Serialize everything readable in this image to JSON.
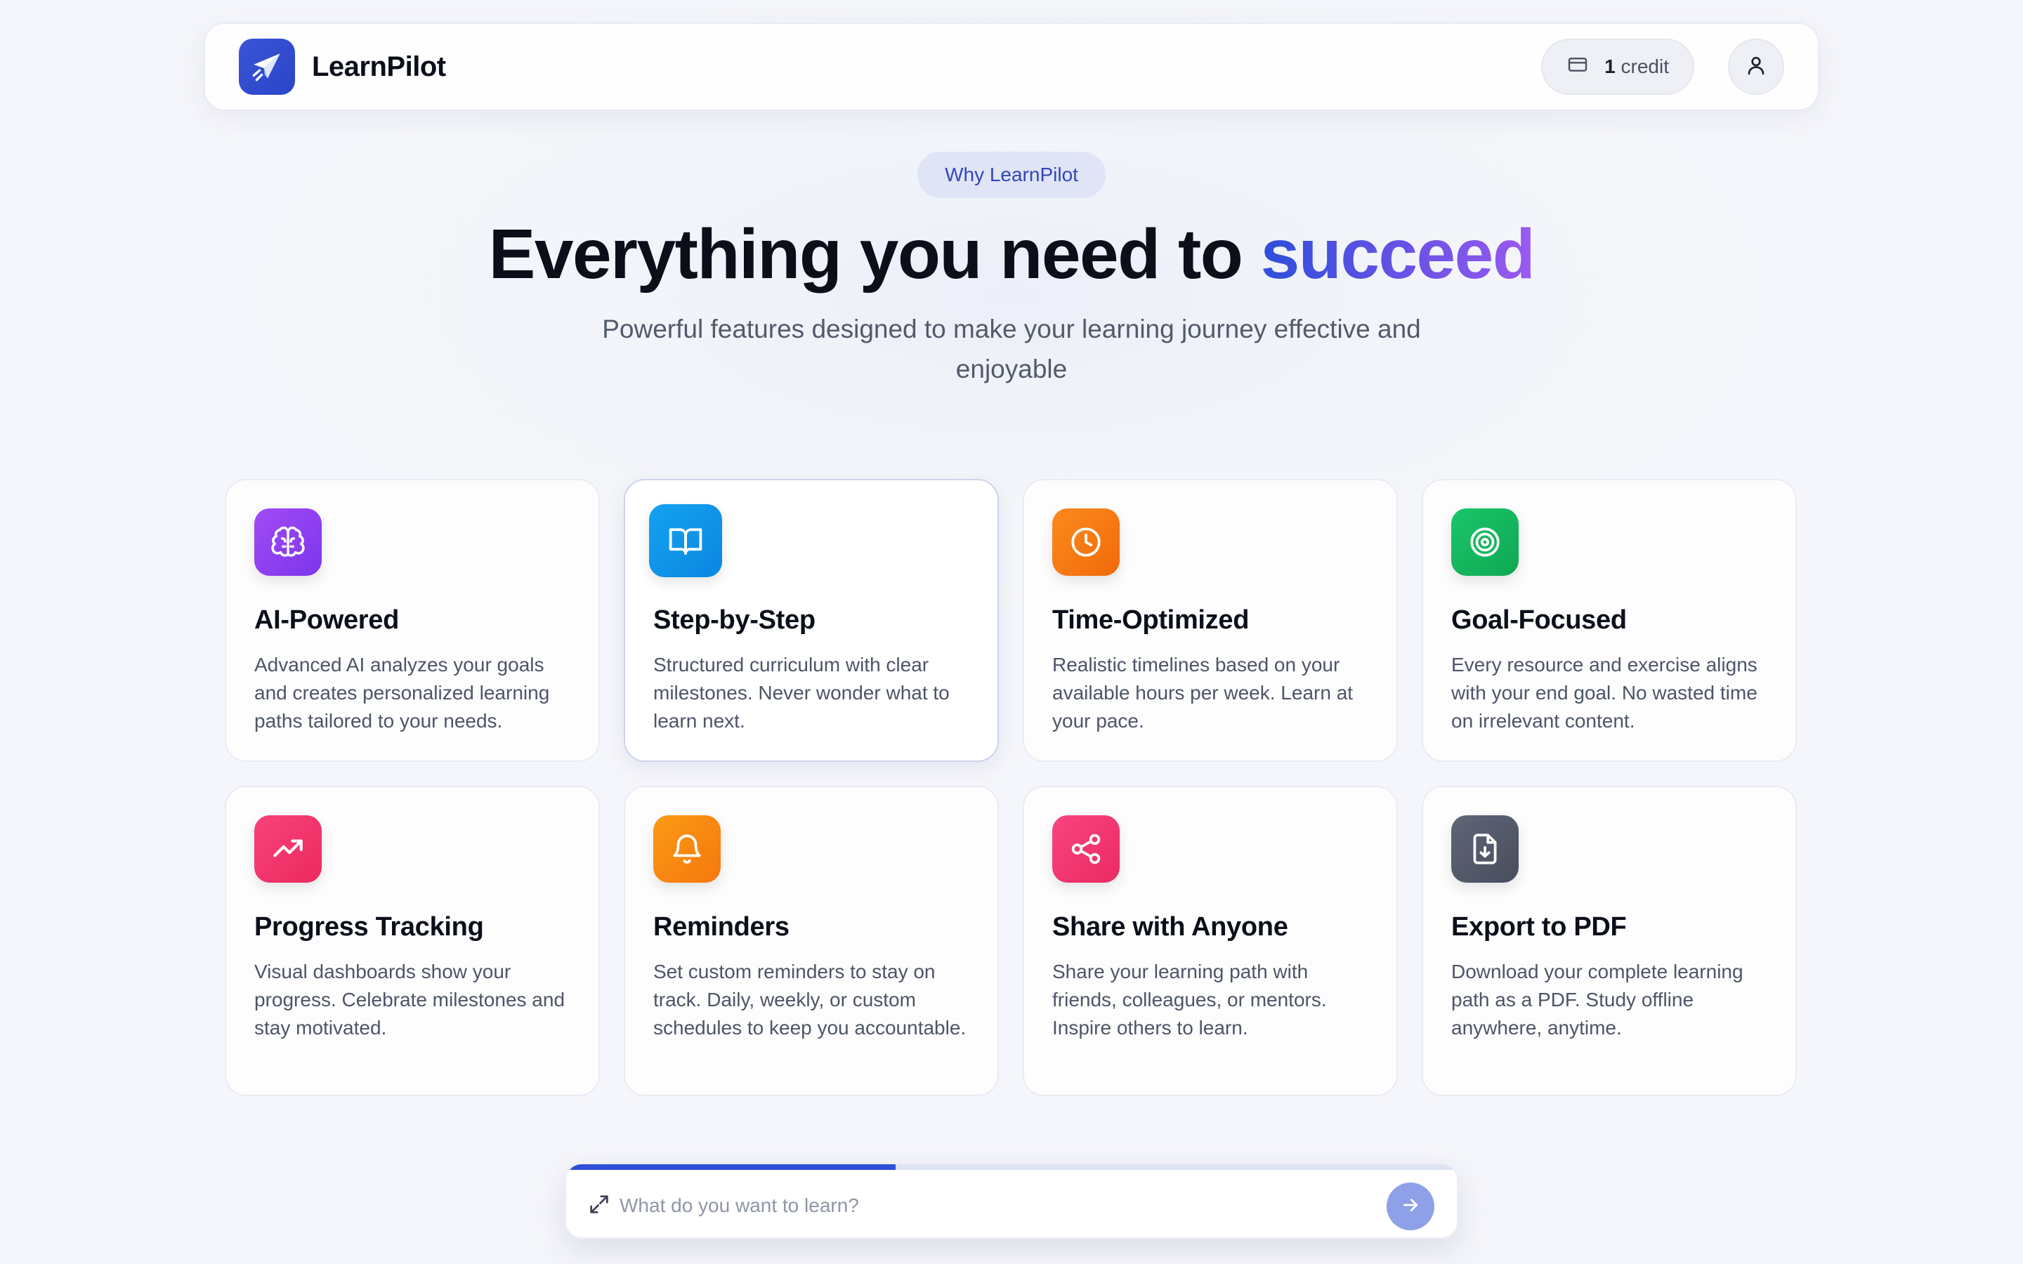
{
  "brand": {
    "name": "LearnPilot"
  },
  "header": {
    "credit_count": "1",
    "credit_label": "credit"
  },
  "hero": {
    "badge": "Why LearnPilot",
    "title_prefix": "Everything you need to ",
    "title_accent": "succeed",
    "subtitle": "Powerful features designed to make your learning journey effective and enjoyable"
  },
  "features": [
    {
      "title": "AI-Powered",
      "description": "Advanced AI analyzes your goals and creates personalized learning paths tailored to your needs.",
      "icon": "brain-icon",
      "color": "#8b3df0"
    },
    {
      "title": "Step-by-Step",
      "description": "Structured curriculum with clear milestones. Never wonder what to learn next.",
      "icon": "book-open-icon",
      "color": "#0f93e8"
    },
    {
      "title": "Time-Optimized",
      "description": "Realistic timelines based on your available hours per week. Learn at your pace.",
      "icon": "clock-icon",
      "color": "#f97a12"
    },
    {
      "title": "Goal-Focused",
      "description": "Every resource and exercise aligns with your end goal. No wasted time on irrelevant content.",
      "icon": "target-icon",
      "color": "#12b65c"
    },
    {
      "title": "Progress Tracking",
      "description": "Visual dashboards show your progress. Celebrate milestones and stay motivated.",
      "icon": "trending-up-icon",
      "color": "#f0336a"
    },
    {
      "title": "Reminders",
      "description": "Set custom reminders to stay on track. Daily, weekly, or custom schedules to keep you accountable.",
      "icon": "bell-icon",
      "color": "#f98a10"
    },
    {
      "title": "Share with Anyone",
      "description": "Share your learning path with friends, colleagues, or mentors. Inspire others to learn.",
      "icon": "share-icon",
      "color": "#f1336e"
    },
    {
      "title": "Export to PDF",
      "description": "Download your complete learning path as a PDF. Study offline anywhere, anytime.",
      "icon": "file-download-icon",
      "color": "#525a6a"
    }
  ],
  "prompt": {
    "placeholder": "What do you want to learn?",
    "value": "",
    "progress": 0.37
  },
  "colors": {
    "accent": "#2f4fd6",
    "accent_purple": "#9b5af0"
  }
}
